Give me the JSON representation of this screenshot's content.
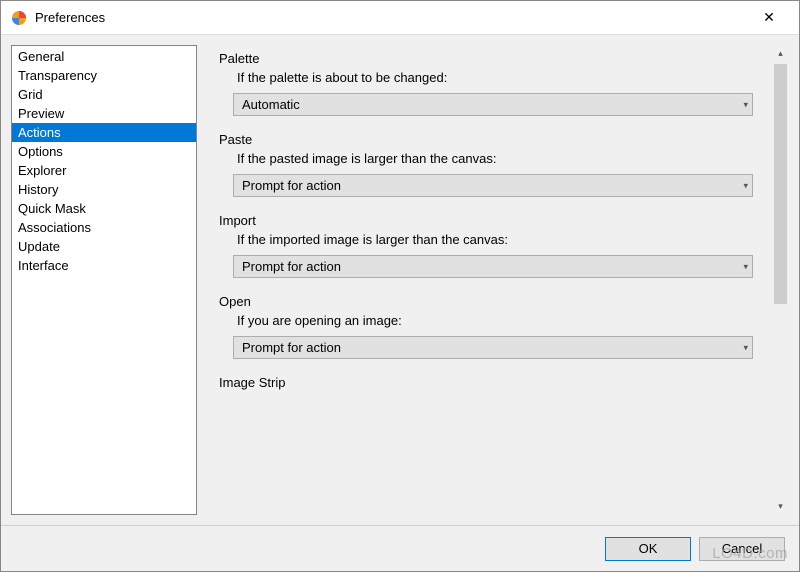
{
  "window": {
    "title": "Preferences",
    "close_label": "✕"
  },
  "sidebar": {
    "items": [
      {
        "label": "General"
      },
      {
        "label": "Transparency"
      },
      {
        "label": "Grid"
      },
      {
        "label": "Preview"
      },
      {
        "label": "Actions",
        "selected": true
      },
      {
        "label": "Options"
      },
      {
        "label": "Explorer"
      },
      {
        "label": "History"
      },
      {
        "label": "Quick Mask"
      },
      {
        "label": "Associations"
      },
      {
        "label": "Update"
      },
      {
        "label": "Interface"
      }
    ]
  },
  "groups": {
    "palette": {
      "title": "Palette",
      "desc": "If the palette is about to be changed:",
      "value": "Automatic"
    },
    "paste": {
      "title": "Paste",
      "desc": "If the pasted image is larger than the canvas:",
      "value": "Prompt for action"
    },
    "import": {
      "title": "Import",
      "desc": "If the imported  image is larger than the canvas:",
      "value": "Prompt for action"
    },
    "open": {
      "title": "Open",
      "desc": "If you are opening an image:",
      "value": "Prompt for action"
    },
    "image_strip": {
      "title": "Image Strip"
    }
  },
  "footer": {
    "ok": "OK",
    "cancel": "Cancel"
  },
  "watermark": "LO4D.com"
}
